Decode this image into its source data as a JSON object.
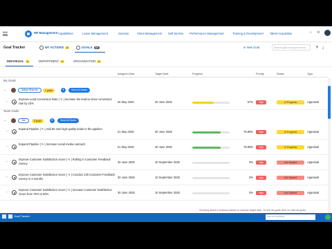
{
  "app": {
    "brand": "HR Management"
  },
  "nav": {
    "items": [
      "Capabilities",
      "Leave Management",
      "Surveys",
      "Client Management",
      "Self Service",
      "Performance Management",
      "Training & Development",
      "Talent Acquisition"
    ]
  },
  "header": {
    "title": "Goal Tracker",
    "my_actions_label": "MY ACTIONS",
    "my_actions_count": "2",
    "goals_label": "GOALS",
    "goals_count": "10",
    "new_goal_label": "New Goal",
    "search_placeholder": "Search goals and goal owners"
  },
  "scopes": [
    {
      "label": "INDIVIDUAL",
      "count": "1"
    },
    {
      "label": "DEPARTMENT",
      "count": "4"
    },
    {
      "label": "ORGANIZATION",
      "count": "5"
    }
  ],
  "columns": [
    "Assigned Date",
    "Target Date",
    "Progress",
    "Priority",
    "Status",
    "Type"
  ],
  "sections": {
    "my_goals": "My Goals",
    "team_goals": "Team Goals"
  },
  "my_group": {
    "name": "Aditya Sharma",
    "count_label": "1 goals",
    "view_all_label": "View All Goals"
  },
  "team_group": {
    "name": "Jon",
    "count_label": "5 goals",
    "view_all_label": "View All Goals"
  },
  "my_rows": [
    {
      "title": "Improve Lead Conversion Rate | ✎ | Increase the lead-to-close conversion rate by 15%",
      "start": "26 May 2025",
      "target": "30 June 2025",
      "progress": 57,
      "progress_label": "57%",
      "priority": "High",
      "status": "In Progress",
      "type": "Appraisal"
    }
  ],
  "team_rows": [
    {
      "title": "Expand Pipeline | ✎ | Add 50 new high-quality leads to the pipeline",
      "start": "21 May 2025",
      "target": "30 June 2025",
      "progress": 75.88,
      "progress_label": "75.88%",
      "priority": "High",
      "status": "In Progress",
      "type": "Appraisal"
    },
    {
      "title": "Expand Pipeline | ✎ | Increase social media outreach",
      "start": "21 May 2025",
      "target": "30 June 2025",
      "progress": 75.88,
      "progress_label": "75.88%",
      "priority": "High",
      "status": "In Progress",
      "type": "Appraisal"
    },
    {
      "title": "Improve Customer Satisfaction Score | ✎ | Rolling in Customer Feedback Survey",
      "start": "30 June 2025",
      "target": "10 September 2025",
      "progress": 0,
      "progress_label": "0%",
      "priority": "High",
      "status": "Not Started",
      "type": "Appraisal"
    },
    {
      "title": "Improve Customer Satisfaction Score | ✎ | Conduct 100 Customer Feedback Survey in 3 months",
      "start": "30 June 2025",
      "target": "10 September 2025",
      "progress": 0,
      "progress_label": "0%",
      "priority": "High",
      "status": "Not Started",
      "type": "Appraisal"
    },
    {
      "title": "Improve Customer Satisfaction Score | ✎ | Increase Customer Satisfaction Score from 75% to 90%",
      "start": "30 June 2025",
      "target": "10 September 2025",
      "progress": 0,
      "progress_label": "0%",
      "priority": "High",
      "status": "Not Started",
      "type": "Appraisal"
    }
  ],
  "footer": {
    "message": "Showing about 6 sections based on nearest target date. To see all goals click on view all goals.",
    "taskbar_label": "Goal Tracker",
    "taskbar_search": "Ask me anything"
  },
  "colors": {
    "accent": "#1f7ae0",
    "progress_yellow": "#f2d21b",
    "progress_green": "#5cb85c",
    "priority_high": "#f25c5c",
    "status_in_progress": "#fdd835",
    "status_not_started": "#f28b82"
  }
}
